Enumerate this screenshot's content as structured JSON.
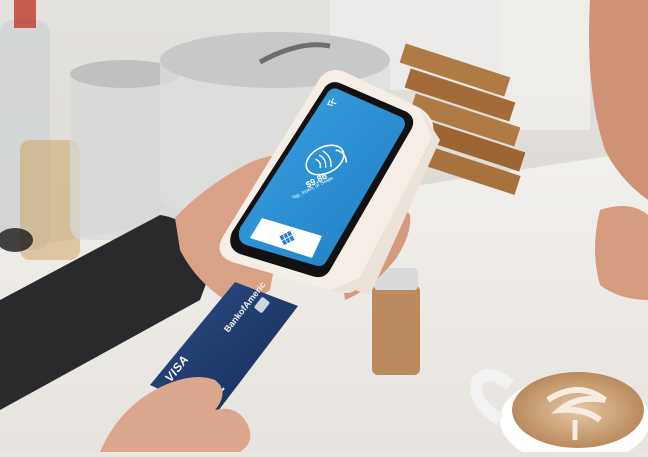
{
  "terminal": {
    "amount": "$9.86",
    "prompt": "Tap, Insert, or Swipe"
  },
  "card": {
    "bank": "BankofAmeric",
    "network": "VISA"
  },
  "colors": {
    "screen_blue": "#2f8fd3",
    "card_navy": "#1d3a6b",
    "counter": "#eeece8",
    "sleeve": "#2a2a2c",
    "skin": "#d9a286",
    "latte": "#c89a6e"
  }
}
